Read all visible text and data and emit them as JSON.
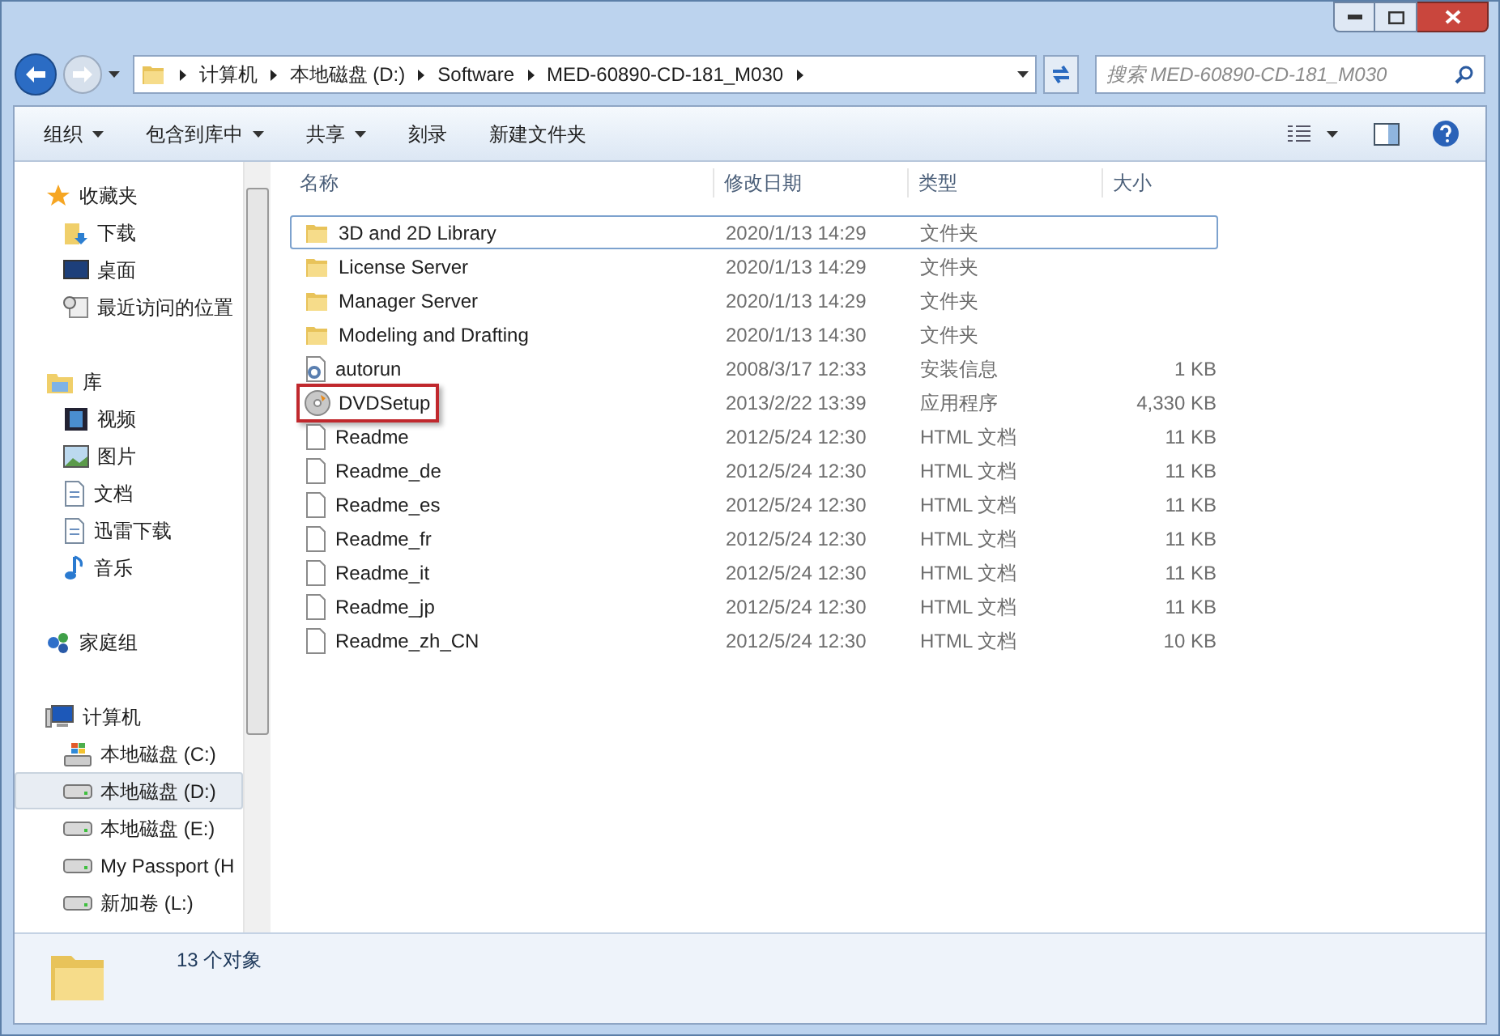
{
  "address_bar": {
    "segments": [
      "计算机",
      "本地磁盘 (D:)",
      "Software",
      "MED-60890-CD-181_M030"
    ]
  },
  "search": {
    "placeholder": "搜索 MED-60890-CD-181_M030"
  },
  "toolbar": {
    "items": [
      {
        "label": "组织",
        "dropdown": true
      },
      {
        "label": "包含到库中",
        "dropdown": true
      },
      {
        "label": "共享",
        "dropdown": true
      },
      {
        "label": "刻录",
        "dropdown": false
      },
      {
        "label": "新建文件夹",
        "dropdown": false
      }
    ]
  },
  "sidebar": {
    "groups": [
      {
        "label": "收藏夹",
        "kind": "favorites",
        "items": [
          {
            "label": "下载",
            "kind": "download",
            "selected": false
          },
          {
            "label": "桌面",
            "kind": "desktop",
            "selected": false
          },
          {
            "label": "最近访问的位置",
            "kind": "recent",
            "selected": false
          }
        ]
      },
      {
        "label": "库",
        "kind": "library",
        "items": [
          {
            "label": "视频",
            "kind": "video",
            "selected": false
          },
          {
            "label": "图片",
            "kind": "picture",
            "selected": false
          },
          {
            "label": "文档",
            "kind": "document",
            "selected": false
          },
          {
            "label": "迅雷下载",
            "kind": "document",
            "selected": false
          },
          {
            "label": "音乐",
            "kind": "music",
            "selected": false
          }
        ]
      },
      {
        "label": "家庭组",
        "kind": "homegroup"
      },
      {
        "label": "计算机",
        "kind": "computer",
        "items": [
          {
            "label": "本地磁盘 (C:)",
            "kind": "system-drive",
            "selected": false
          },
          {
            "label": "本地磁盘 (D:)",
            "kind": "drive",
            "selected": true
          },
          {
            "label": "本地磁盘 (E:)",
            "kind": "drive",
            "selected": false
          },
          {
            "label": "My Passport (H",
            "kind": "drive",
            "selected": false
          },
          {
            "label": "新加卷 (L:)",
            "kind": "drive",
            "selected": false
          }
        ]
      }
    ]
  },
  "table": {
    "columns": [
      "名称",
      "修改日期",
      "类型",
      "大小"
    ],
    "rows": [
      {
        "name": "3D and 2D Library",
        "date": "2020/1/13 14:29",
        "type": "文件夹",
        "kind": "folder",
        "focused": true,
        "highlighted": false
      },
      {
        "name": "License Server",
        "date": "2020/1/13 14:29",
        "type": "文件夹",
        "kind": "folder",
        "focused": false,
        "highlighted": false
      },
      {
        "name": "Manager Server",
        "date": "2020/1/13 14:29",
        "type": "文件夹",
        "kind": "folder",
        "focused": false,
        "highlighted": false
      },
      {
        "name": "Modeling and Drafting",
        "date": "2020/1/13 14:30",
        "type": "文件夹",
        "kind": "folder",
        "focused": false,
        "highlighted": false
      },
      {
        "name": "autorun",
        "date": "2008/3/17 12:33",
        "type": "安装信息",
        "size": "1 KB",
        "kind": "setup-info",
        "focused": false,
        "highlighted": false
      },
      {
        "name": "DVDSetup",
        "date": "2013/2/22 13:39",
        "type": "应用程序",
        "size": "4,330 KB",
        "kind": "disc-app",
        "focused": false,
        "highlighted": true
      },
      {
        "name": "Readme",
        "date": "2012/5/24 12:30",
        "type": "HTML 文档",
        "size": "11 KB",
        "kind": "file",
        "focused": false,
        "highlighted": false
      },
      {
        "name": "Readme_de",
        "date": "2012/5/24 12:30",
        "type": "HTML 文档",
        "size": "11 KB",
        "kind": "file",
        "focused": false,
        "highlighted": false
      },
      {
        "name": "Readme_es",
        "date": "2012/5/24 12:30",
        "type": "HTML 文档",
        "size": "11 KB",
        "kind": "file",
        "focused": false,
        "highlighted": false
      },
      {
        "name": "Readme_fr",
        "date": "2012/5/24 12:30",
        "type": "HTML 文档",
        "size": "11 KB",
        "kind": "file",
        "focused": false,
        "highlighted": false
      },
      {
        "name": "Readme_it",
        "date": "2012/5/24 12:30",
        "type": "HTML 文档",
        "size": "11 KB",
        "kind": "file",
        "focused": false,
        "highlighted": false
      },
      {
        "name": "Readme_jp",
        "date": "2012/5/24 12:30",
        "type": "HTML 文档",
        "size": "11 KB",
        "kind": "file",
        "focused": false,
        "highlighted": false
      },
      {
        "name": "Readme_zh_CN",
        "date": "2012/5/24 12:30",
        "type": "HTML 文档",
        "size": "10 KB",
        "kind": "file",
        "focused": false,
        "highlighted": false
      }
    ]
  },
  "status_bar": {
    "text": "13 个对象"
  }
}
